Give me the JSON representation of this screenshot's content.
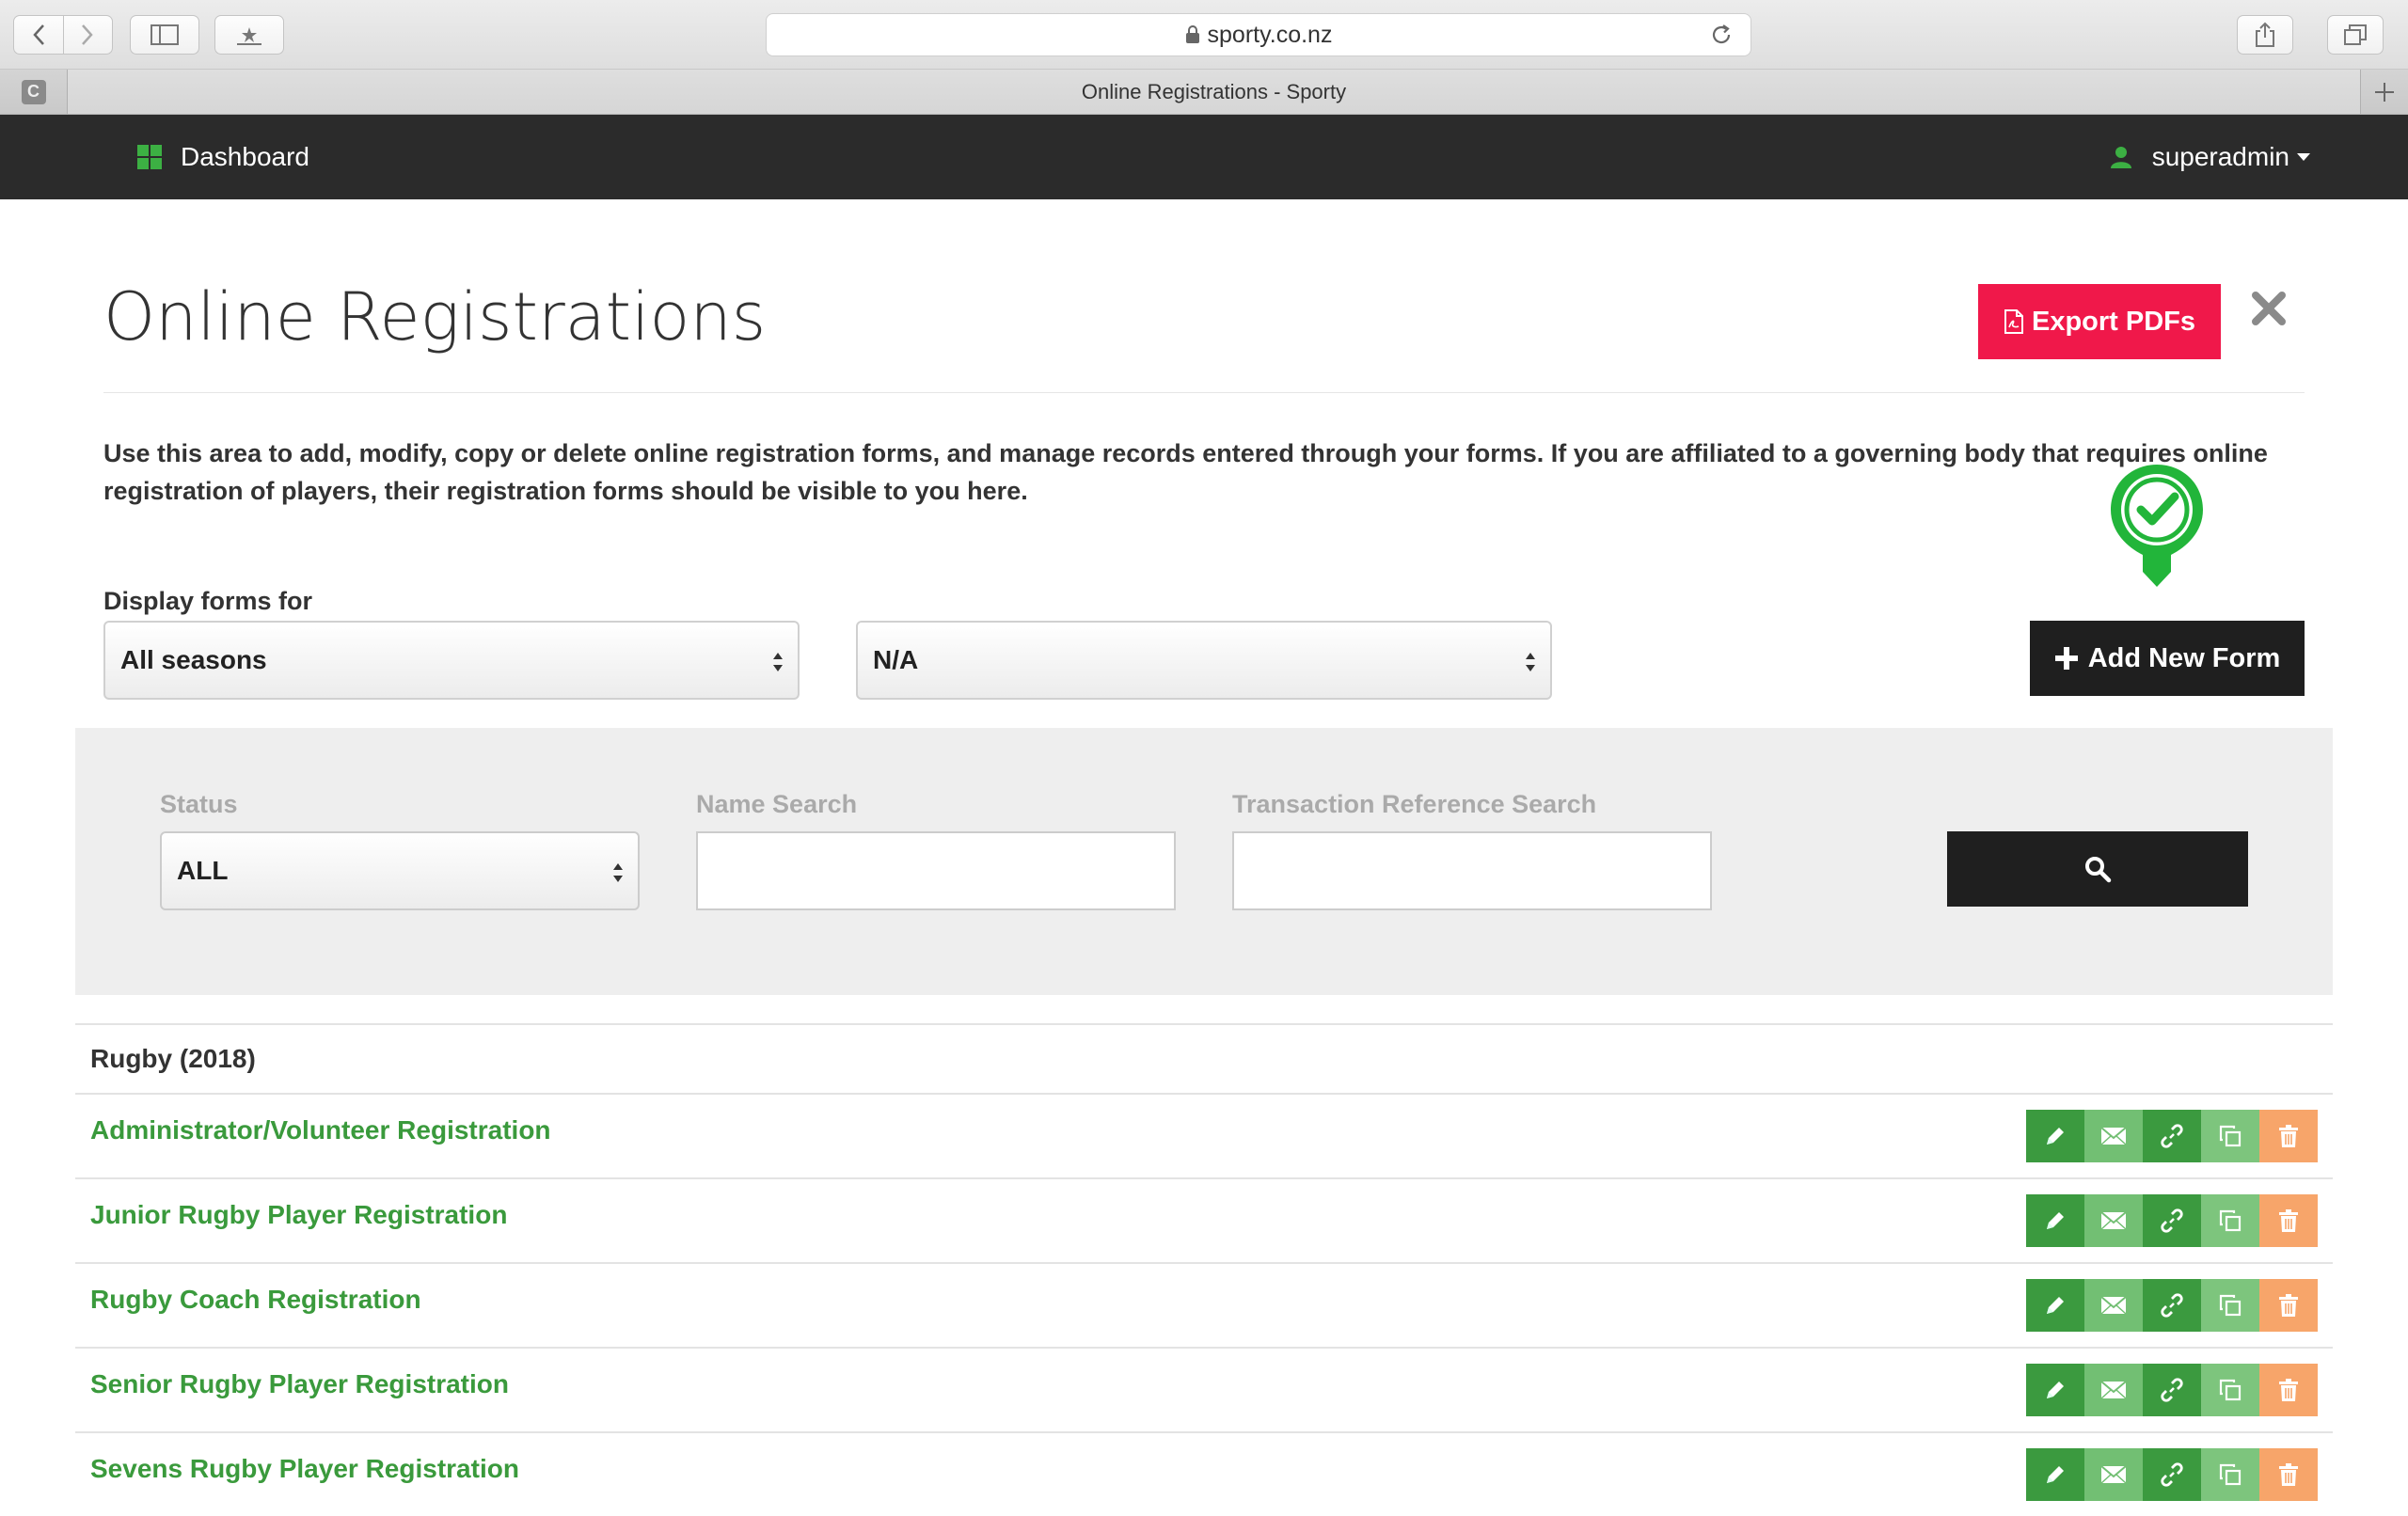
{
  "browser": {
    "url": "sporty.co.nz",
    "tab_title": "Online Registrations - Sporty",
    "pinned_tab_letter": "C"
  },
  "nav": {
    "dashboard_label": "Dashboard",
    "user_label": "superadmin"
  },
  "page": {
    "title": "Online Registrations",
    "export_label": "Export PDFs",
    "intro": "Use this area to add, modify, copy or delete online registration forms, and manage records entered through your forms. If you are affiliated to a governing body that requires online registration of players, their registration forms should be visible to you here.",
    "display_label": "Display forms for",
    "season_value": "All seasons",
    "second_value": "N/A",
    "add_label": "Add New Form"
  },
  "filter": {
    "status_label": "Status",
    "status_value": "ALL",
    "name_label": "Name Search",
    "name_value": "",
    "txn_label": "Transaction Reference Search",
    "txn_value": ""
  },
  "forms": {
    "group_title": "Rugby (2018)",
    "rows": [
      {
        "name": "Administrator/Volunteer Registration"
      },
      {
        "name": "Junior Rugby Player Registration"
      },
      {
        "name": "Rugby Coach Registration"
      },
      {
        "name": "Senior Rugby Player Registration"
      },
      {
        "name": "Sevens Rugby Player Registration"
      }
    ]
  },
  "colors": {
    "nav_bg": "#2b2b2b",
    "brand_green": "#3a9a3c",
    "export_red": "#f0184a",
    "delete_orange": "#f7a56a"
  }
}
